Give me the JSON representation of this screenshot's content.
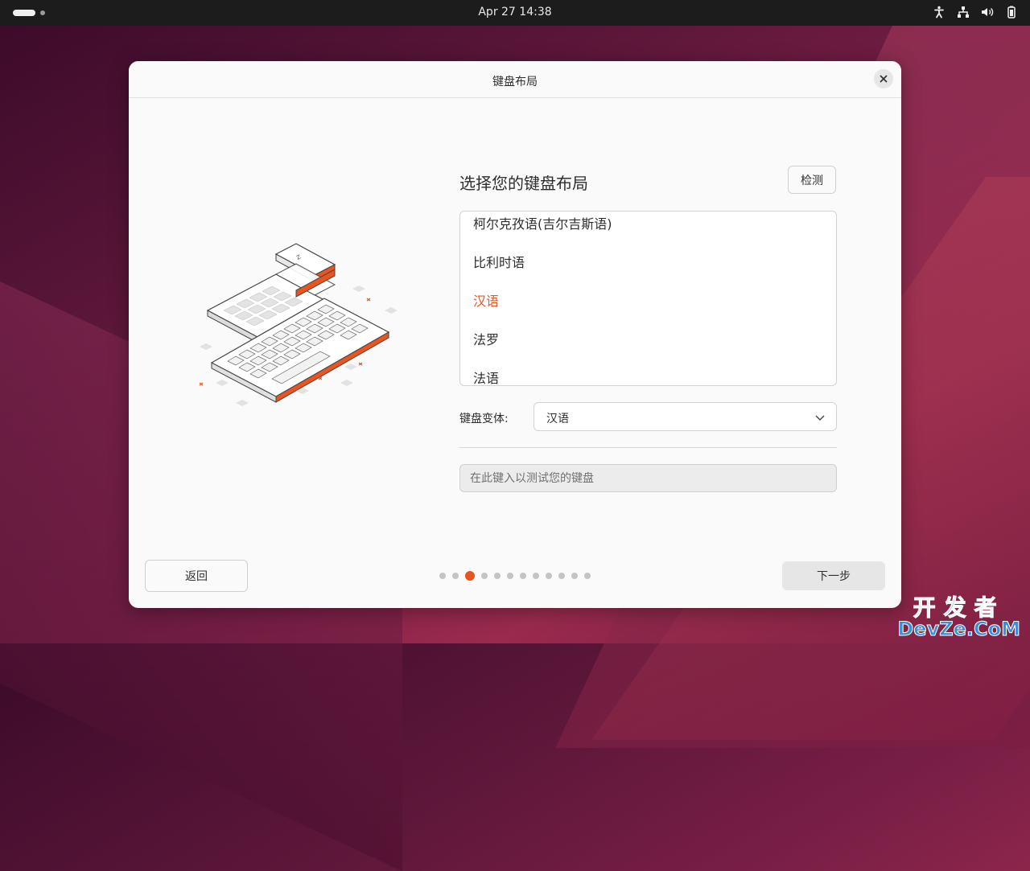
{
  "topbar": {
    "clock": "Apr 27  14:38"
  },
  "dialog": {
    "title": "键盘布局",
    "heading": "选择您的键盘布局",
    "detect_label": "检测",
    "layouts": [
      {
        "label": "柯尔克孜语(吉尔吉斯语)",
        "selected": false
      },
      {
        "label": "比利时语",
        "selected": false
      },
      {
        "label": "汉语",
        "selected": true
      },
      {
        "label": "法罗",
        "selected": false
      },
      {
        "label": "法语",
        "selected": false
      }
    ],
    "variant_label": "键盘变体:",
    "variant_value": "汉语",
    "test_placeholder": "在此键入以测试您的键盘",
    "back_label": "返回",
    "next_label": "下一步",
    "progress": {
      "total": 12,
      "current": 3
    }
  },
  "colors": {
    "accent": "#e95420"
  },
  "watermark": {
    "line1": "开发者",
    "line2": "DevZe.CoM"
  }
}
